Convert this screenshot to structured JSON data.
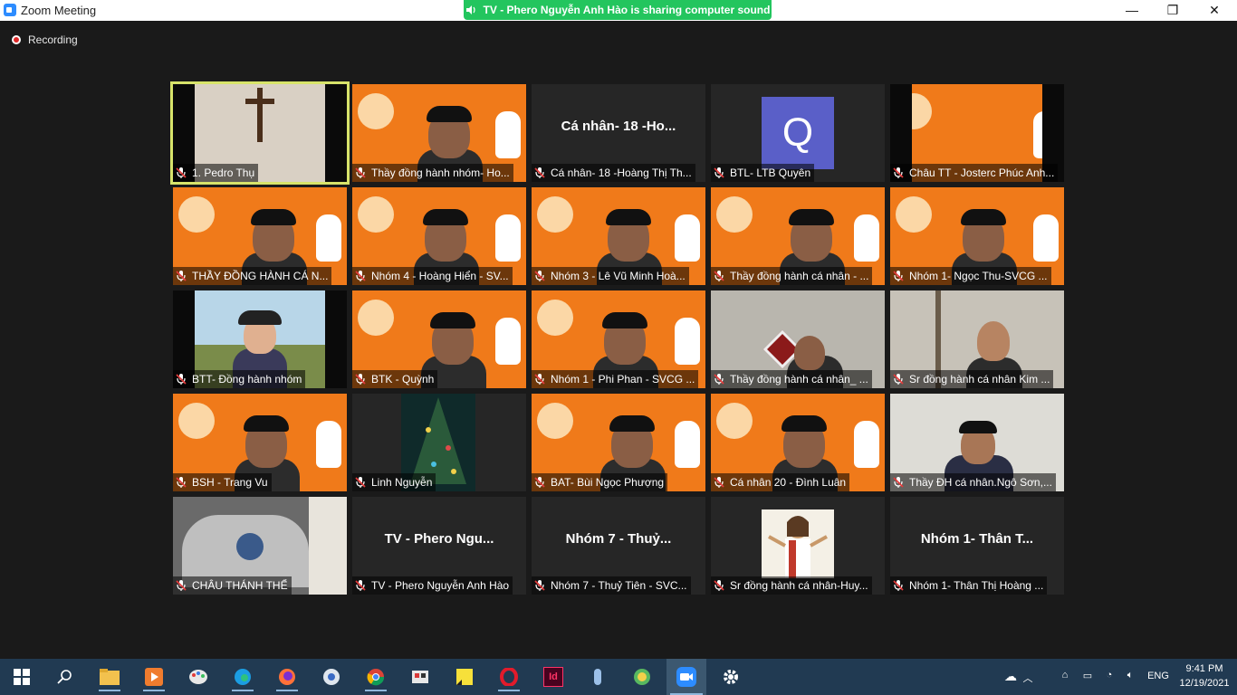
{
  "window": {
    "title": "Zoom Meeting",
    "minimize": "—",
    "restore": "❐",
    "close": "✕"
  },
  "share_banner": {
    "text": "TV - Phero Nguyễn Anh Hào is sharing computer sound"
  },
  "recording": {
    "label": "Recording"
  },
  "participants": [
    {
      "name": "1. Pedro Thụ",
      "video": "cross",
      "active": true
    },
    {
      "name": "Thầy đồng hành nhóm- Ho...",
      "video": "orange-person"
    },
    {
      "name": "Cá nhân- 18 -Hoàng Thị Th...",
      "video": "none",
      "center": "Cá nhân- 18 -Ho..."
    },
    {
      "name": "BTL- LTB Quyên",
      "video": "avatar",
      "avatar": "Q"
    },
    {
      "name": "Châu TT - Josterc Phúc Anh...",
      "video": "orange-pillar"
    },
    {
      "name": "THẦY ĐỒNG HÀNH  CÁ N...",
      "video": "orange-person"
    },
    {
      "name": "Nhóm 4 - Hoàng Hiển - SV...",
      "video": "orange-person"
    },
    {
      "name": "Nhóm 3 - Lê Vũ Minh Hoà...",
      "video": "orange-person"
    },
    {
      "name": "Thầy đồng hành cá nhân - ...",
      "video": "orange-person"
    },
    {
      "name": "Nhóm 1- Ngọc Thu-SVCG ...",
      "video": "orange-person"
    },
    {
      "name": "BTT- Đồng hành nhóm",
      "video": "outdoor"
    },
    {
      "name": "BTK - Quỳnh",
      "video": "orange-person"
    },
    {
      "name": "Nhóm 1 - Phi Phan - SVCG ...",
      "video": "orange-person"
    },
    {
      "name": "Thầy đồng hành cá nhân_ ...",
      "video": "room"
    },
    {
      "name": "Sr đồng hành cá nhân Kim ...",
      "video": "room-grey"
    },
    {
      "name": "BSH - Trang Vu",
      "video": "orange-person"
    },
    {
      "name": "Linh Nguyễn",
      "video": "tree"
    },
    {
      "name": "BAT- Bùi Ngọc Phượng",
      "video": "orange-person"
    },
    {
      "name": "Cá nhân 20 - Đình Luân",
      "video": "orange-person"
    },
    {
      "name": "Thầy ĐH cá nhân.Ngô Sơn,...",
      "video": "room-light"
    },
    {
      "name": "CHÂU THÁNH THỂ",
      "video": "nativity"
    },
    {
      "name": "TV - Phero Nguyễn Anh Hào",
      "video": "none",
      "center": "TV - Phero Ngu..."
    },
    {
      "name": "Nhóm 7 - Thuỷ Tiên - SVC...",
      "video": "none",
      "center": "Nhóm 7 - Thuỷ..."
    },
    {
      "name": "Sr đồng hành cá nhân-Huy...",
      "video": "jesus"
    },
    {
      "name": "Nhóm 1- Thân Thị Hoàng ...",
      "video": "none",
      "center": "Nhóm 1- Thân T..."
    }
  ],
  "taskbar": {
    "icons": [
      "windows-start-icon",
      "search-icon",
      "file-explorer-icon",
      "media-player-icon",
      "paint-icon",
      "edge-icon",
      "firefox-icon",
      "app-icon",
      "chrome-icon",
      "app2-icon",
      "sticky-notes-icon",
      "opera-icon",
      "indesign-icon",
      "app3-icon",
      "app4-icon",
      "zoom-icon",
      "settings-icon"
    ],
    "language": "ENG",
    "time": "9:41 PM",
    "date": "12/19/2021",
    "indesign_label": "Id"
  },
  "colors": {
    "active_border": "#d7e36a",
    "banner_green": "#23c55e",
    "taskbar": "#213a52",
    "orange_slide": "#f07a1a"
  }
}
